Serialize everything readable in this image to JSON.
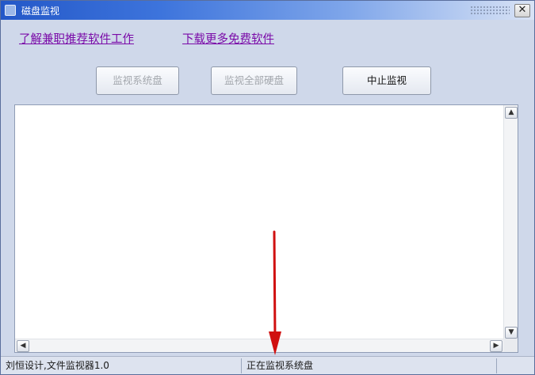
{
  "window": {
    "title": "磁盘监视",
    "close_symbol": "✕"
  },
  "links": {
    "learn_parttime": "了解兼职推荐软件工作",
    "download_free": "下载更多免费软件"
  },
  "buttons": {
    "monitor_system_disk": "监视系统盘",
    "monitor_all_disks": "监视全部硬盘",
    "stop_monitoring": "中止监视"
  },
  "scrollbar": {
    "up": "▲",
    "down": "▼",
    "left": "◀",
    "right": "▶"
  },
  "status": {
    "left": "刘恒设计,文件监视器1.0",
    "right": "正在监视系统盘"
  },
  "colors": {
    "window_bg": "#cfd8ea",
    "link": "#7a0aa8",
    "annotation_arrow": "#d01010"
  },
  "icons": [
    "app-icon",
    "close-icon",
    "resize-grip-icon",
    "scroll-arrow-icons",
    "annotation-arrow"
  ]
}
